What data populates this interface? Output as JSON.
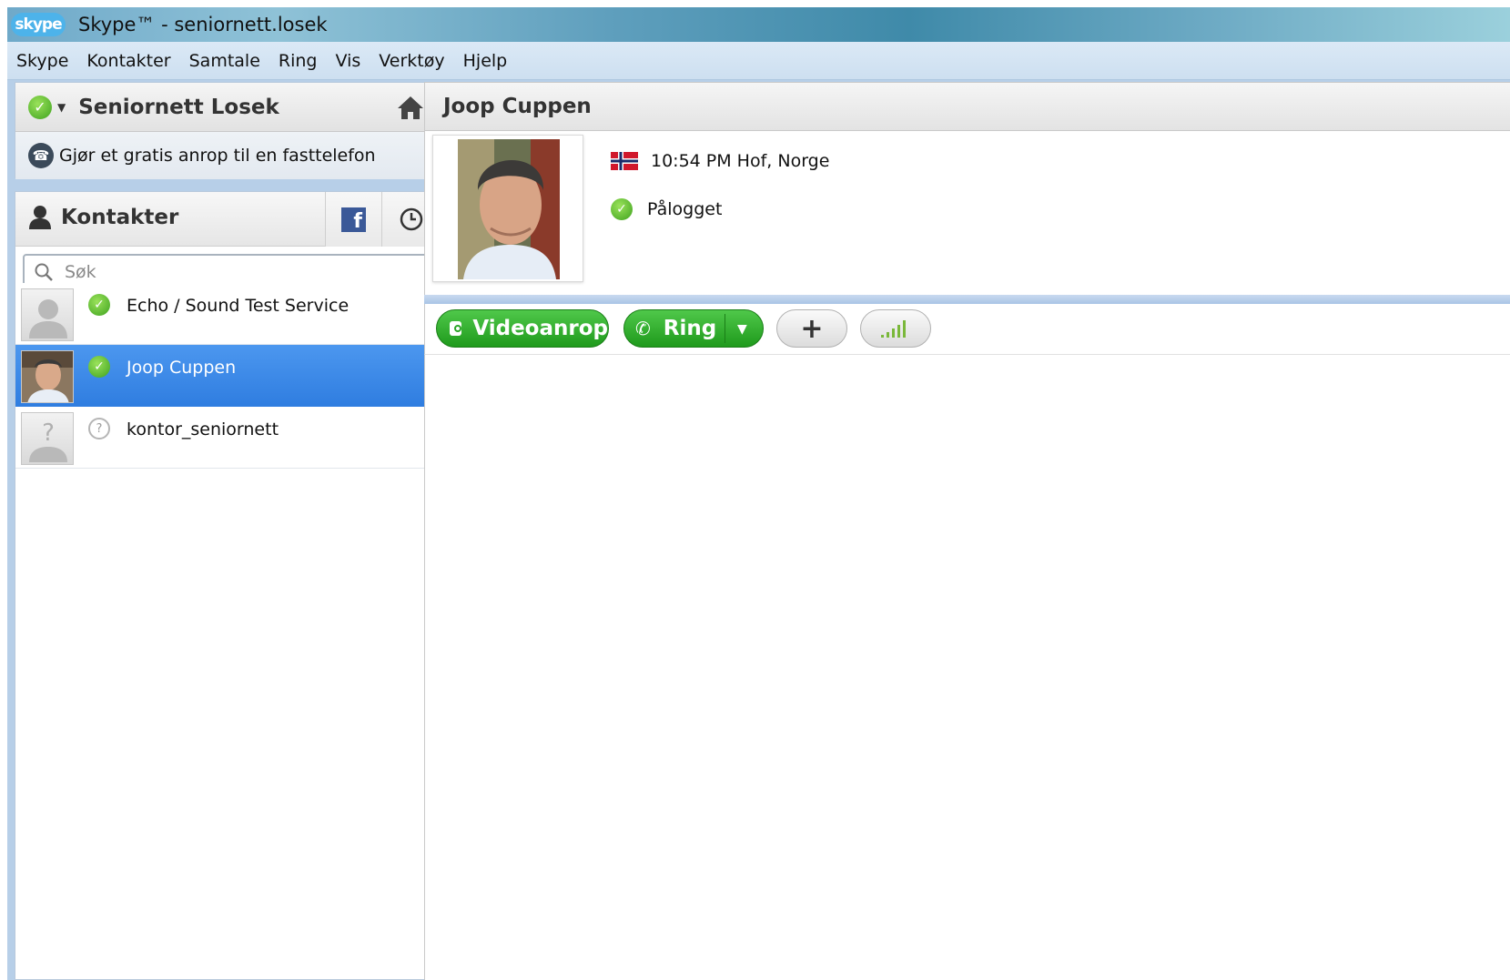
{
  "window": {
    "logo_text": "skype",
    "title": "Skype™ - seniornett.losek"
  },
  "menu": [
    "Skype",
    "Kontakter",
    "Samtale",
    "Ring",
    "Vis",
    "Verktøy",
    "Hjelp"
  ],
  "profile": {
    "name": "Seniornett Losek",
    "status_icon": "online-status-icon",
    "free_call_text": "Gjør et gratis anrop til en fasttelefon"
  },
  "contacts": {
    "title": "Kontakter",
    "search_placeholder": "Søk",
    "items": [
      {
        "name": "Echo / Sound Test Service",
        "status": "online",
        "avatar": "default-avatar"
      },
      {
        "name": "Joop Cuppen",
        "status": "online",
        "avatar": "photo",
        "selected": true
      },
      {
        "name": "kontor_seniornett",
        "status": "unknown",
        "avatar": "unknown-avatar"
      }
    ]
  },
  "conversation": {
    "contact_name": "Joop Cuppen",
    "local_time_location": "10:54 PM Hof, Norge",
    "status_text": "Pålogget",
    "country_flag": "norway-flag-icon"
  },
  "actions": {
    "video_label": "Videoanrop",
    "call_label": "Ring"
  },
  "colors": {
    "green_button": "#2aa526",
    "selected_row": "#3b88e8",
    "online": "#5fc23a",
    "facebook": "#3b5998"
  }
}
